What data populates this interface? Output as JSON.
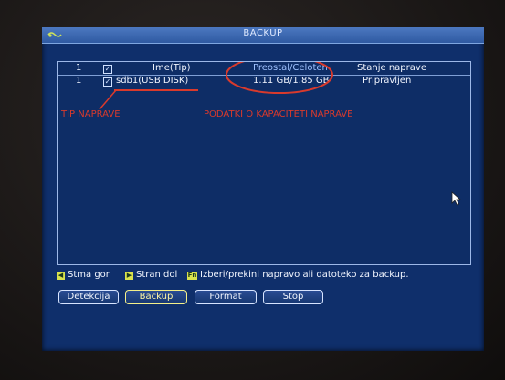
{
  "window": {
    "title": "BACKUP"
  },
  "table": {
    "header": {
      "index": "1",
      "name": "Ime(Tip)",
      "capacity": "Preostal/Celoten",
      "status": "Stanje naprave"
    },
    "rows": [
      {
        "index": "1",
        "name": "sdb1(USB DISK)",
        "capacity": "1.11 GB/1.85 GB",
        "status": "Pripravljen",
        "checked": true
      }
    ]
  },
  "annotations": {
    "device_type": "TIP NAPRAVE",
    "capacity_info": "PODATKI O KAPACITETI NAPRAVE"
  },
  "help": {
    "prev_key": "◀",
    "prev_text": "Stma gor",
    "next_key": "▶",
    "next_text": "Stran dol",
    "fn_key": "Fn",
    "fn_text": "Izberi/prekini napravo ali datoteko za backup."
  },
  "buttons": {
    "detect": "Detekcija",
    "backup": "Backup",
    "format": "Format",
    "stop": "Stop"
  },
  "colors": {
    "screen": "#0f2f6b",
    "annotation": "#d93a2c",
    "text": "#f2f6ff"
  }
}
